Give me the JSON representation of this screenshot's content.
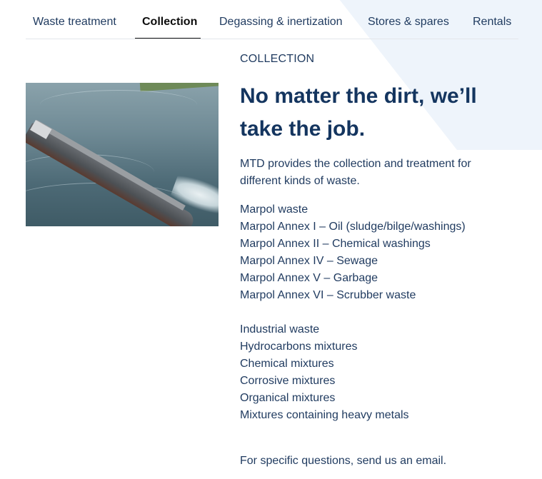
{
  "tabs": [
    {
      "label": "Waste treatment",
      "active": false
    },
    {
      "label": "Collection",
      "active": true
    },
    {
      "label": "Degassing & inertization",
      "active": false
    },
    {
      "label": "Stores & spares",
      "active": false
    },
    {
      "label": "Rentals",
      "active": false
    }
  ],
  "section": {
    "eyebrow": "COLLECTION",
    "headline": "No matter the dirt, we’ll take the job.",
    "intro": "MTD provides the collection and treatment for different kinds of waste."
  },
  "marpol": [
    "Marpol waste",
    "Marpol Annex I – Oil (sludge/bilge/washings)",
    "Marpol Annex II – Chemical washings",
    "Marpol Annex IV – Sewage",
    "Marpol Annex V – Garbage",
    "Marpol Annex VI – Scrubber waste"
  ],
  "industrial": [
    "Industrial waste",
    "Hydrocarbons mixtures",
    "Chemical mixtures",
    "Corrosive mixtures",
    "Organical mixtures",
    "Mixtures containing heavy metals"
  ],
  "cta": "For specific questions, send us an email.",
  "colors": {
    "heading": "#14355f",
    "text": "#1f3a5f",
    "active_tab": "#0d0d0d",
    "accent_bg": "#eef4fb"
  }
}
